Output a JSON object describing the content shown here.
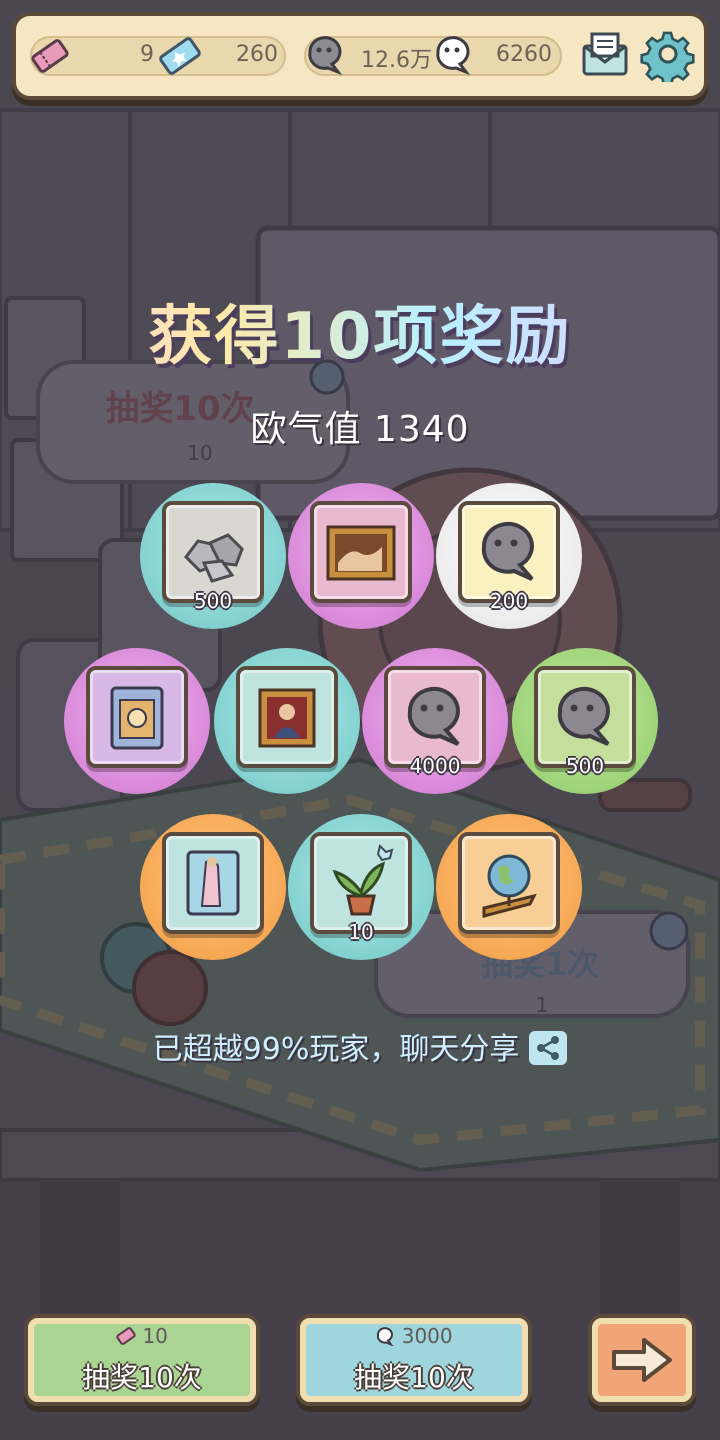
{
  "resources": {
    "ticket_pink_count": "9",
    "ticket_blue_count": "260",
    "ghost_grey_count": "12.6万",
    "ghost_white_count": "6260"
  },
  "background_text": {
    "left_panel_label": "抽奖10次",
    "left_panel_cost": "10",
    "right_panel_label": "抽奖1次",
    "right_panel_cost": "1"
  },
  "result": {
    "title": "获得10项奖励",
    "luck_label": "欧气值 1340"
  },
  "rewards": [
    {
      "name": "rocks",
      "quantity": "500"
    },
    {
      "name": "painting-nude",
      "quantity": ""
    },
    {
      "name": "grey-ghost",
      "quantity": "200"
    },
    {
      "name": "book",
      "quantity": ""
    },
    {
      "name": "painting-madonna",
      "quantity": ""
    },
    {
      "name": "grey-ghost",
      "quantity": "4000"
    },
    {
      "name": "grey-ghost",
      "quantity": "500"
    },
    {
      "name": "book-figure",
      "quantity": ""
    },
    {
      "name": "potted-plant",
      "quantity": "10"
    },
    {
      "name": "globe",
      "quantity": ""
    }
  ],
  "share": {
    "text": "已超越99%玩家，聊天分享"
  },
  "buttons": {
    "draw_ticket": {
      "cost": "10",
      "label": "抽奖10次"
    },
    "draw_ghost": {
      "cost": "3000",
      "label": "抽奖10次"
    }
  },
  "colors": {
    "frame": "#5b4a3a",
    "topbar_bg": "#f6e7c2",
    "button_green": "#a9d493",
    "button_blue": "#9fd6dd",
    "button_orange": "#f1a577"
  }
}
